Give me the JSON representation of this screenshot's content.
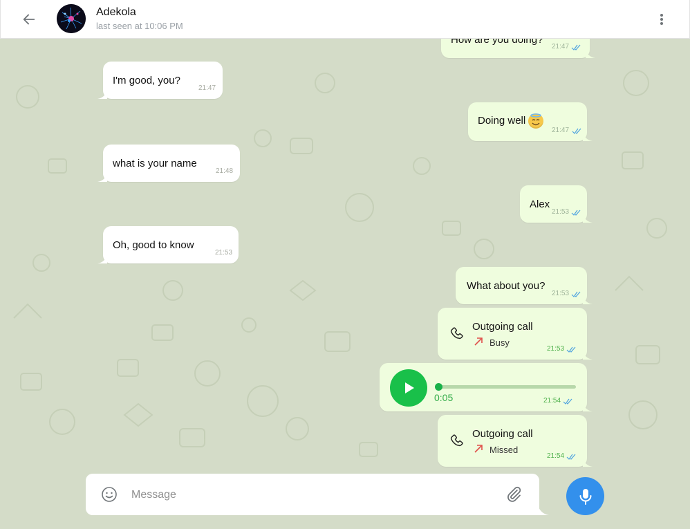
{
  "header": {
    "contact_name": "Adekola",
    "status": "last seen at 10:06 PM"
  },
  "messages": [
    {
      "id": "m1",
      "direction": "out",
      "text": "How are you doing?",
      "time": "21:47",
      "read": true
    },
    {
      "id": "m2",
      "direction": "in",
      "text": "I'm good, you?",
      "time": "21:47"
    },
    {
      "id": "m3",
      "direction": "out",
      "text": "Doing well",
      "emoji": "smiling-face-with-halo",
      "time": "21:47",
      "read": true
    },
    {
      "id": "m4",
      "direction": "in",
      "text": "what is your name",
      "time": "21:48"
    },
    {
      "id": "m5",
      "direction": "out",
      "text": "Alex",
      "time": "21:53",
      "read": true
    },
    {
      "id": "m6",
      "direction": "in",
      "text": "Oh, good to know",
      "time": "21:53"
    },
    {
      "id": "m7",
      "direction": "out",
      "text": "What about you?",
      "time": "21:53",
      "read": true
    },
    {
      "id": "m8",
      "direction": "out",
      "type": "call",
      "title": "Outgoing call",
      "status": "Busy",
      "time": "21:53",
      "read": true
    },
    {
      "id": "m9",
      "direction": "out",
      "type": "voice",
      "duration": "0:05",
      "progress": 0,
      "time": "21:54",
      "read": true
    },
    {
      "id": "m10",
      "direction": "out",
      "type": "call",
      "title": "Outgoing call",
      "status": "Missed",
      "time": "21:54",
      "read": true
    }
  ],
  "composer": {
    "placeholder": "Message"
  },
  "icons": {
    "back": "arrow-left-icon",
    "menu": "more-vertical-icon",
    "emoji": "smiley-icon",
    "attach": "paperclip-icon",
    "mic": "microphone-icon",
    "call": "phone-icon",
    "call_outgoing": "arrow-up-right-icon",
    "play": "play-icon",
    "read": "double-check-icon"
  },
  "colors": {
    "accent": "#3390ec",
    "outgoing_bubble": "#effdde",
    "incoming_bubble": "#ffffff",
    "voice_play": "#19c04a",
    "call_arrow": "#e0504a",
    "chat_background": "#d4dcc8"
  }
}
